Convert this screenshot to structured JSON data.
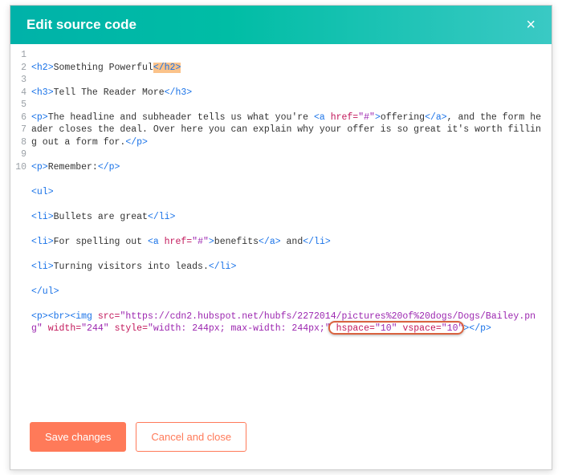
{
  "header": {
    "title": "Edit source code",
    "close": "×"
  },
  "code": {
    "line_numbers": [
      "1",
      "2",
      "3",
      "",
      "4",
      "5",
      "6",
      "7",
      "8",
      "9",
      "10",
      ""
    ],
    "l1": {
      "open": "<h2>",
      "text": "Something Powerful",
      "close": "</h2>"
    },
    "l2": {
      "open": "<h3>",
      "text": "Tell The Reader More",
      "close": "</h3>"
    },
    "l3": {
      "open": "<p>",
      "t1": "The headline and subheader tells us what you're ",
      "a_open": "<a ",
      "a_attr": "href=",
      "a_val": "\"#\"",
      "a_end": ">",
      "t2": "offering",
      "a_close": "</a>",
      "t3": ", and the form header closes the deal. Over here you can explain why your offer is so great it's worth filling out a form for.",
      "close": "</p>"
    },
    "l4": {
      "open": "<p>",
      "text": "Remember:",
      "close": "</p>"
    },
    "l5": {
      "open": "<ul>"
    },
    "l6": {
      "open": "<li>",
      "text": "Bullets are great",
      "close": "</li>"
    },
    "l7": {
      "open": "<li>",
      "t1": "For spelling out ",
      "a_open": "<a ",
      "a_attr": "href=",
      "a_val": "\"#\"",
      "a_end": ">",
      "t2": "benefits",
      "a_close": "</a>",
      "t3": " and",
      "close": "</li>"
    },
    "l8": {
      "open": "<li>",
      "text": "Turning visitors into leads.",
      "close": "</li>"
    },
    "l9": {
      "close": "</ul>"
    },
    "l10": {
      "p_open": "<p>",
      "br": "<br>",
      "img_open": "<img ",
      "src_a": "src=",
      "src_v": "\"https://cdn2.hubspot.net/hubfs/2272014/pictures%20of%20dogs/Dogs/Bailey.png\"",
      "sp1": " ",
      "w_a": "width=",
      "w_v": "\"244\"",
      "sp2": " ",
      "style_a": "style=",
      "style_v": "\"width: 244px; max-width: 244px;\"",
      "hs_a": " hspace=",
      "hs_v": "\"10\"",
      "vs_a": " vspace=",
      "vs_v": "\"10\"",
      "img_close": ">",
      "p_close": "</p>"
    }
  },
  "footer": {
    "save": "Save changes",
    "cancel": "Cancel and close"
  }
}
